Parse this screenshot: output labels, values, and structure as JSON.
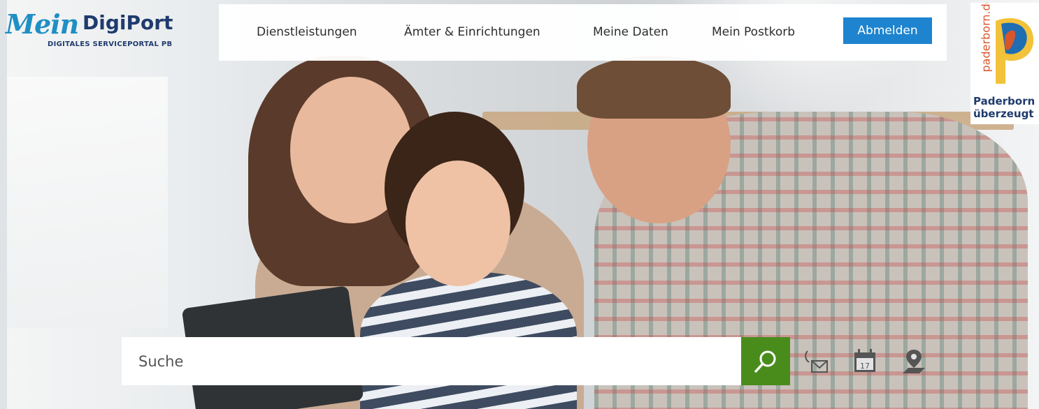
{
  "logo": {
    "mein": "Mein",
    "digiport": "DigiPort",
    "subtitle": "DIGITALES SERVICEPORTAL PB"
  },
  "nav": {
    "items": [
      {
        "label": "Dienstleistungen"
      },
      {
        "label": "Ämter & Einrichtungen"
      },
      {
        "label": "Meine Daten"
      },
      {
        "label": "Mein Postkorb"
      }
    ],
    "logout_label": "Abmelden"
  },
  "badge": {
    "vertical": "paderborn.de",
    "line1": "Paderborn",
    "line2": "überzeugt"
  },
  "search": {
    "placeholder": "Suche"
  },
  "quick_icons": [
    "mail-icon",
    "calendar-icon",
    "location-pin-icon"
  ],
  "calendar_day": "17",
  "colors": {
    "logout_bg": "#1e84cf",
    "search_button": "#4a8c1c",
    "logo_blue": "#1f3b6e",
    "logo_light_blue": "#1f8fc4"
  }
}
